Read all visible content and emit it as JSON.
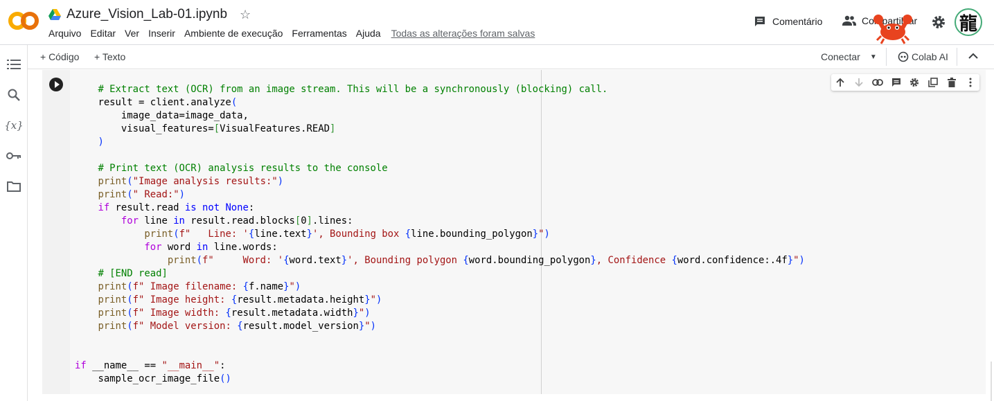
{
  "header": {
    "logo": "CO",
    "notebook_title": "Azure_Vision_Lab-01.ipynb",
    "menu": [
      "Arquivo",
      "Editar",
      "Ver",
      "Inserir",
      "Ambiente de execução",
      "Ferramentas",
      "Ajuda"
    ],
    "save_status": "Todas as alterações foram salvas",
    "comment_label": "Comentário",
    "share_label": "Compartilhar",
    "avatar_char": "龍"
  },
  "toolbar": {
    "add_code": "+ Código",
    "add_text": "+ Texto",
    "connect": "Conectar",
    "colab_ai": "Colab AI"
  },
  "rail_icons": [
    "toc-icon",
    "search-icon",
    "variables-icon",
    "key-icon",
    "folder-icon"
  ],
  "colors": {
    "brand_orange": "#f9ab00",
    "keyword": "#0000ff",
    "comment": "#008000",
    "string": "#a31515"
  },
  "code_lines": [
    [
      [
        "    ",
        ""
      ],
      [
        "# Extract text (OCR) from an image stream. This will be a synchronously (blocking) call.",
        "cm"
      ]
    ],
    [
      [
        "    result = client.analyze",
        ""
      ],
      [
        "(",
        "br"
      ]
    ],
    [
      [
        "        image_data=image_data,",
        ""
      ]
    ],
    [
      [
        "        visual_features=",
        ""
      ],
      [
        "[",
        "br2"
      ],
      [
        "VisualFeatures.READ",
        ""
      ],
      [
        "]",
        "br2"
      ]
    ],
    [
      [
        "    ",
        ""
      ],
      [
        ")",
        "br"
      ]
    ],
    [
      [
        "",
        ""
      ]
    ],
    [
      [
        "    ",
        ""
      ],
      [
        "# Print text (OCR) analysis results to the console",
        "cm"
      ]
    ],
    [
      [
        "    ",
        ""
      ],
      [
        "print",
        "fn"
      ],
      [
        "(",
        "br"
      ],
      [
        "\"Image analysis results:\"",
        "str"
      ],
      [
        ")",
        "br"
      ]
    ],
    [
      [
        "    ",
        ""
      ],
      [
        "print",
        "fn"
      ],
      [
        "(",
        "br"
      ],
      [
        "\" Read:\"",
        "str"
      ],
      [
        ")",
        "br"
      ]
    ],
    [
      [
        "    ",
        ""
      ],
      [
        "if",
        "ctl"
      ],
      [
        " result.read ",
        ""
      ],
      [
        "is not None",
        "kw"
      ],
      [
        ":",
        ""
      ]
    ],
    [
      [
        "        ",
        ""
      ],
      [
        "for",
        "ctl"
      ],
      [
        " line ",
        ""
      ],
      [
        "in",
        "kw"
      ],
      [
        " result.read.blocks",
        ""
      ],
      [
        "[",
        "br2"
      ],
      [
        "0",
        ""
      ],
      [
        "]",
        "br2"
      ],
      [
        ".lines:",
        ""
      ]
    ],
    [
      [
        "            ",
        ""
      ],
      [
        "print",
        "fn"
      ],
      [
        "(",
        "br"
      ],
      [
        "f\"   Line: '",
        "str"
      ],
      [
        "{",
        "br"
      ],
      [
        "line.text",
        ""
      ],
      [
        "}",
        "br"
      ],
      [
        "', Bounding box ",
        "str"
      ],
      [
        "{",
        "br"
      ],
      [
        "line.bounding_polygon",
        ""
      ],
      [
        "}",
        "br"
      ],
      [
        "\"",
        "str"
      ],
      [
        ")",
        "br"
      ]
    ],
    [
      [
        "            ",
        ""
      ],
      [
        "for",
        "ctl"
      ],
      [
        " word ",
        ""
      ],
      [
        "in",
        "kw"
      ],
      [
        " line.words:",
        ""
      ]
    ],
    [
      [
        "                ",
        ""
      ],
      [
        "print",
        "fn"
      ],
      [
        "(",
        "br"
      ],
      [
        "f\"     Word: '",
        "str"
      ],
      [
        "{",
        "br"
      ],
      [
        "word.text",
        ""
      ],
      [
        "}",
        "br"
      ],
      [
        "', Bounding polygon ",
        "str"
      ],
      [
        "{",
        "br"
      ],
      [
        "word.bounding_polygon",
        ""
      ],
      [
        "}",
        "br"
      ],
      [
        ", Confidence ",
        "str"
      ],
      [
        "{",
        "br"
      ],
      [
        "word.confidence:.4f",
        ""
      ],
      [
        "}",
        "br"
      ],
      [
        "\"",
        "str"
      ],
      [
        ")",
        "br"
      ]
    ],
    [
      [
        "    ",
        ""
      ],
      [
        "# [END read]",
        "cm"
      ]
    ],
    [
      [
        "    ",
        ""
      ],
      [
        "print",
        "fn"
      ],
      [
        "(",
        "br"
      ],
      [
        "f\" Image filename: ",
        "str"
      ],
      [
        "{",
        "br"
      ],
      [
        "f.name",
        ""
      ],
      [
        "}",
        "br"
      ],
      [
        "\"",
        "str"
      ],
      [
        ")",
        "br"
      ]
    ],
    [
      [
        "    ",
        ""
      ],
      [
        "print",
        "fn"
      ],
      [
        "(",
        "br"
      ],
      [
        "f\" Image height: ",
        "str"
      ],
      [
        "{",
        "br"
      ],
      [
        "result.metadata.height",
        ""
      ],
      [
        "}",
        "br"
      ],
      [
        "\"",
        "str"
      ],
      [
        ")",
        "br"
      ]
    ],
    [
      [
        "    ",
        ""
      ],
      [
        "print",
        "fn"
      ],
      [
        "(",
        "br"
      ],
      [
        "f\" Image width: ",
        "str"
      ],
      [
        "{",
        "br"
      ],
      [
        "result.metadata.width",
        ""
      ],
      [
        "}",
        "br"
      ],
      [
        "\"",
        "str"
      ],
      [
        ")",
        "br"
      ]
    ],
    [
      [
        "    ",
        ""
      ],
      [
        "print",
        "fn"
      ],
      [
        "(",
        "br"
      ],
      [
        "f\" Model version: ",
        "str"
      ],
      [
        "{",
        "br"
      ],
      [
        "result.model_version",
        ""
      ],
      [
        "}",
        "br"
      ],
      [
        "\"",
        "str"
      ],
      [
        ")",
        "br"
      ]
    ],
    [
      [
        "",
        ""
      ]
    ],
    [
      [
        "",
        ""
      ]
    ],
    [
      [
        "if",
        "ctl"
      ],
      [
        " __name__ == ",
        ""
      ],
      [
        "\"__main__\"",
        "str"
      ],
      [
        ":",
        ""
      ]
    ],
    [
      [
        "    sample_ocr_image_file",
        ""
      ],
      [
        "()",
        "br"
      ]
    ]
  ]
}
